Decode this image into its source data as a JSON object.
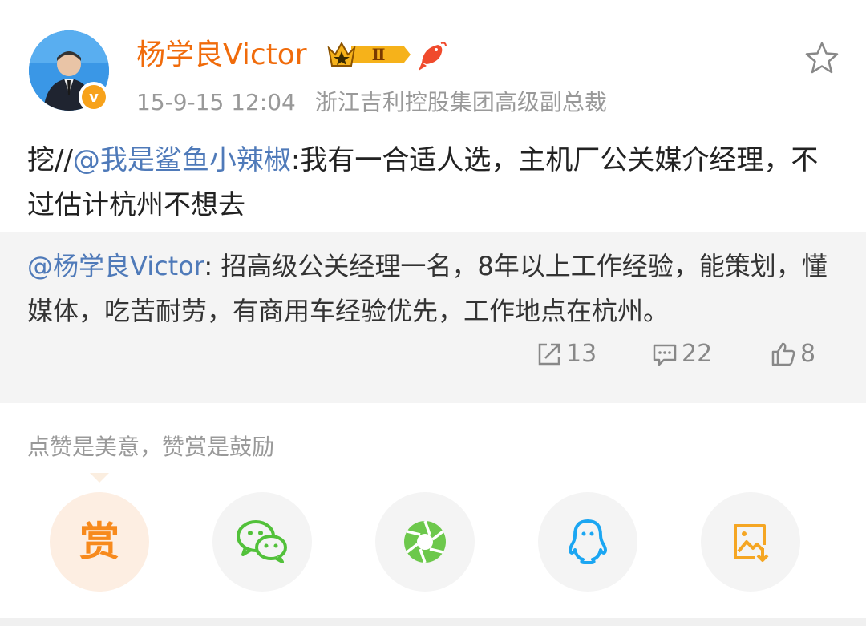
{
  "user": {
    "name": "杨学良Victor",
    "level_badge": "Ⅱ",
    "verified_mark": "v",
    "time": "15-9-15 12:04",
    "title": "浙江吉利控股集团高级副总裁"
  },
  "post": {
    "prefix": "挖//",
    "mention": "@我是鲨鱼小辣椒",
    "text": ":我有一合适人选，主机厂公关媒介经理，不过估计杭州不想去"
  },
  "repost": {
    "mention": "@杨学良Victor",
    "text": ": 招高级公关经理一名，8年以上工作经验，能策划，懂媒体，吃苦耐劳，有商用车经验优先，工作地点在杭州。",
    "reposts": "13",
    "comments": "22",
    "likes": "8"
  },
  "reward_hint": "点赞是美意，赞赏是鼓励",
  "share": {
    "reward_label": "赏",
    "items": [
      "reward-icon",
      "wechat-icon",
      "moments-icon",
      "qq-icon",
      "save-image-icon"
    ]
  },
  "colors": {
    "username": "#f06b0b",
    "mention": "#4f7ab9",
    "reward": "#f78a1d",
    "wechat": "#52c13a",
    "qq": "#1ba6f2",
    "save": "#f5a623"
  }
}
